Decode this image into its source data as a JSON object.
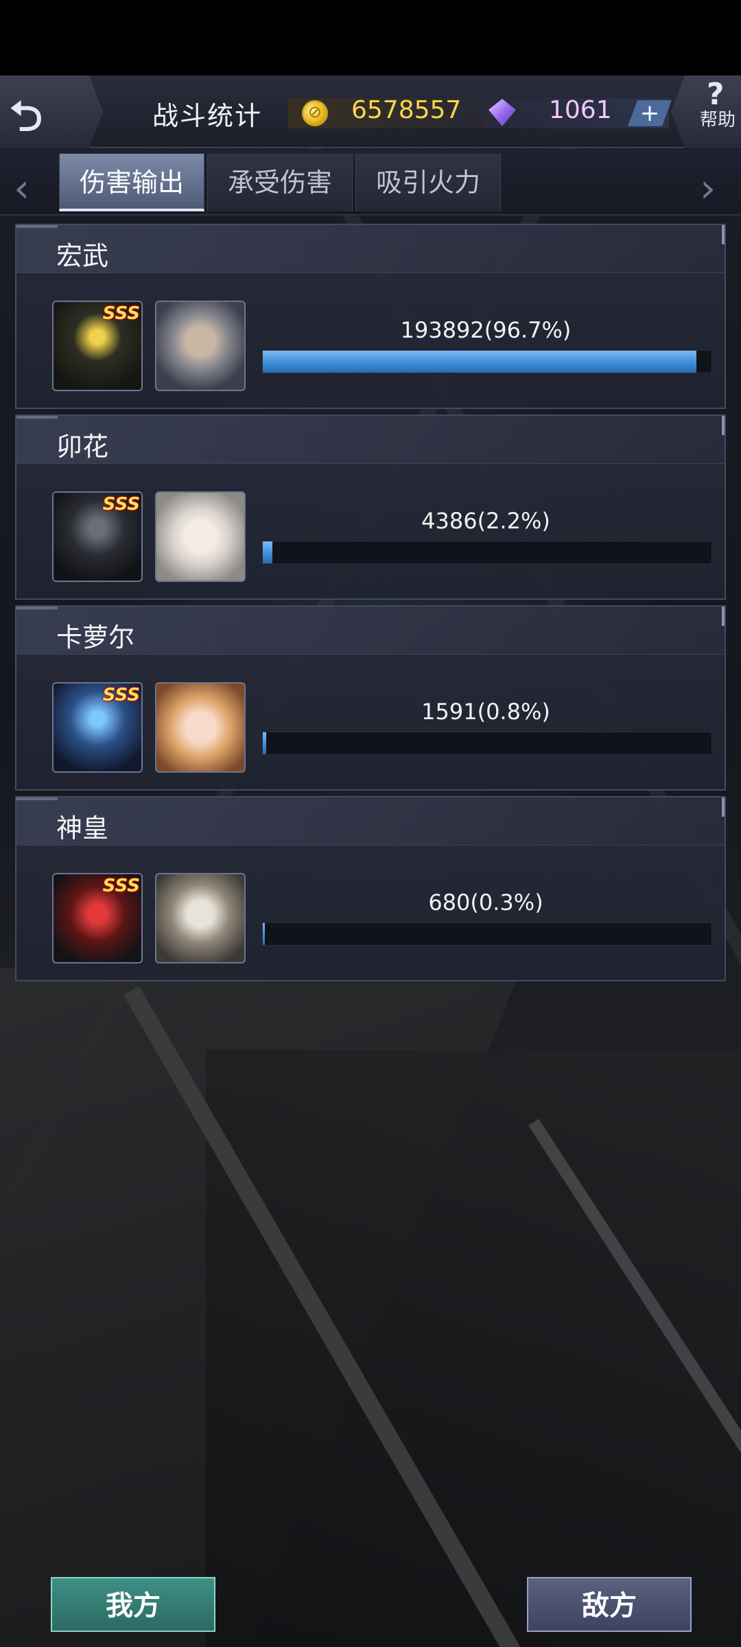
{
  "header": {
    "back_icon": "back-arrow-icon",
    "title": "战斗统计",
    "gold": "6578557",
    "gems": "1061",
    "plus_label": "+",
    "help_label": "帮助",
    "help_glyph": "?"
  },
  "tabs": [
    {
      "label": "伤害输出",
      "active": true
    },
    {
      "label": "承受伤害",
      "active": false
    },
    {
      "label": "吸引火力",
      "active": false
    }
  ],
  "nav": {
    "prev": "‹",
    "next": "›"
  },
  "entries": [
    {
      "name": "宏武",
      "grade": "SSS",
      "stat": "193892(96.7%)",
      "fraction": 0.967
    },
    {
      "name": "卯花",
      "grade": "SSS",
      "stat": "4386(2.2%)",
      "fraction": 0.022
    },
    {
      "name": "卡萝尔",
      "grade": "SSS",
      "stat": "1591(0.8%)",
      "fraction": 0.008
    },
    {
      "name": "神皇",
      "grade": "SSS",
      "stat": "680(0.3%)",
      "fraction": 0.003
    }
  ],
  "footer": {
    "mine_label": "我方",
    "enemy_label": "敌方"
  },
  "colors": {
    "accent_gold": "#ffd54a",
    "accent_gem": "#f4c6ff",
    "bar_fill": "#3a8ad6",
    "button_mine": "#3e8f84",
    "button_enemy": "#5a6280"
  }
}
